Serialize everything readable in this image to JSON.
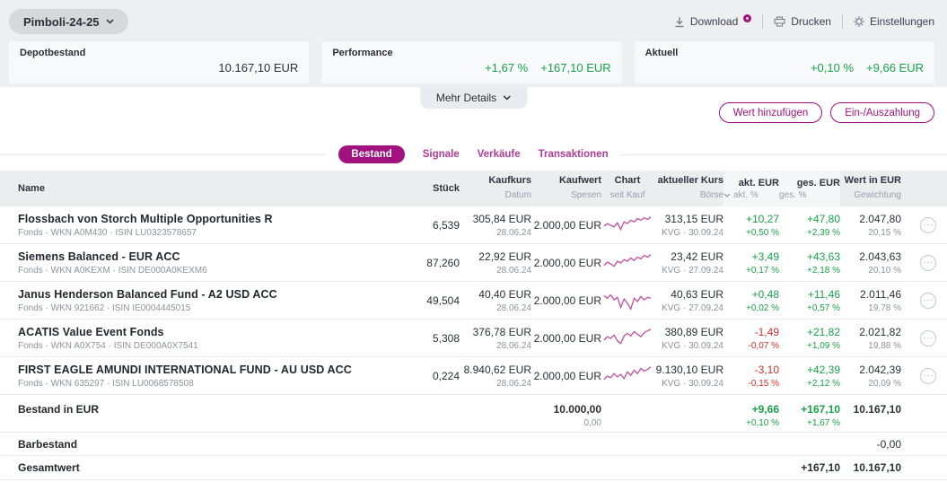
{
  "toolbar": {
    "portfolio": "Pimboli-24-25",
    "download": "Download",
    "print": "Drucken",
    "settings": "Einstellungen"
  },
  "summary": {
    "depot": {
      "label": "Depotbestand",
      "value": "10.167,10 EUR"
    },
    "performance": {
      "label": "Performance",
      "percent": "+1,67 %",
      "value": "+167,10 EUR"
    },
    "aktuell": {
      "label": "Aktuell",
      "percent": "+0,10 %",
      "value": "+9,66 EUR"
    },
    "more_details": "Mehr Details"
  },
  "actions": {
    "add_value": "Wert hinzufügen",
    "pay_in_out": "Ein-/Auszahlung"
  },
  "tabs": {
    "bestand": "Bestand",
    "signale": "Signale",
    "verkaeufe": "Verkäufe",
    "transaktionen": "Transaktionen"
  },
  "table": {
    "columns": {
      "name": "Name",
      "stueck": "Stück",
      "kaufkurs": "Kaufkurs",
      "datum": "Datum",
      "kaufwert": "Kaufwert",
      "spesen": "Spesen",
      "chart": "Chart",
      "seit_kauf": "seit Kauf",
      "kurs": "aktueller Kurs",
      "boerse": "Börse",
      "akt_eur": "akt. EUR",
      "akt_pct": "akt. %",
      "ges_eur": "ges. EUR",
      "ges_pct": "ges. %",
      "wert": "Wert in EUR",
      "gewichtung": "Gewichtung"
    },
    "rows": [
      {
        "name": "Flossbach von Storch Multiple Opportunities R",
        "meta": "Fonds · WKN A0M430 · ISIN LU0323578657",
        "stueck": "6,539",
        "kaufkurs": "305,84 EUR",
        "datum": "28.06.24",
        "kaufwert": "2.000,00 EUR",
        "kurs": "313,15 EUR",
        "boerse": "KVG · 30.09.24",
        "akt_eur": "+10,27",
        "akt_pct": "+0,50 %",
        "ges_eur": "+47,80",
        "ges_pct": "+2,39 %",
        "wert": "2.047,80",
        "gewichtung": "20,15 %",
        "spark": [
          13,
          10,
          12,
          14,
          9,
          17,
          8,
          10,
          6,
          8,
          4,
          6,
          3,
          5,
          2
        ]
      },
      {
        "name": "Siemens Balanced - EUR ACC",
        "meta": "Fonds · WKN A0KEXM · ISIN DE000A0KEXM6",
        "stueck": "87,260",
        "kaufkurs": "22,92 EUR",
        "datum": "28.06.24",
        "kaufwert": "2.000,00 EUR",
        "kurs": "23,42 EUR",
        "boerse": "KVG · 27.09.24",
        "akt_eur": "+3,49",
        "akt_pct": "+0,17 %",
        "ges_eur": "+43,63",
        "ges_pct": "+2,18 %",
        "wert": "2.043,63",
        "gewichtung": "20,10 %",
        "spark": [
          15,
          11,
          13,
          16,
          10,
          12,
          8,
          10,
          6,
          9,
          5,
          7,
          3,
          5,
          2
        ]
      },
      {
        "name": "Janus Henderson Balanced Fund - A2 USD ACC",
        "meta": "Fonds · WKN 921662 · ISIN IE0004445015",
        "stueck": "49,504",
        "kaufkurs": "40,40 EUR",
        "datum": "28.06.24",
        "kaufwert": "2.000,00 EUR",
        "kurs": "40,63 EUR",
        "boerse": "KVG · 27.09.24",
        "akt_eur": "+0,48",
        "akt_pct": "+0,02 %",
        "ges_eur": "+11,46",
        "ges_pct": "+0,57 %",
        "wert": "2.011,46",
        "gewichtung": "19,78 %",
        "spark": [
          6,
          9,
          5,
          11,
          8,
          20,
          10,
          15,
          22,
          9,
          13,
          7,
          11,
          8,
          9
        ]
      },
      {
        "name": "ACATIS Value Event Fonds",
        "meta": "Fonds · WKN A0X754 · ISIN DE000A0X7541",
        "stueck": "5,308",
        "kaufkurs": "376,78 EUR",
        "datum": "28.06.24",
        "kaufwert": "2.000,00 EUR",
        "kurs": "380,89 EUR",
        "boerse": "KVG · 30.09.24",
        "akt_eur": "-1,49",
        "akt_pct": "-0,07 %",
        "ges_eur": "+21,82",
        "ges_pct": "+1,09 %",
        "wert": "2.021,82",
        "gewichtung": "19,88 %",
        "spark": [
          14,
          10,
          12,
          8,
          15,
          18,
          9,
          6,
          9,
          4,
          7,
          10,
          5,
          3,
          1
        ]
      },
      {
        "name": "FIRST EAGLE AMUNDI INTERNATIONAL FUND - AU USD ACC",
        "meta": "Fonds · WKN 635297 · ISIN LU0068578508",
        "stueck": "0,224",
        "kaufkurs": "8.940,62 EUR",
        "datum": "28.06.24",
        "kaufwert": "2.000,00 EUR",
        "kurs": "9.130,10 EUR",
        "boerse": "KVG · 30.09.24",
        "akt_eur": "-3,10",
        "akt_pct": "-0,15 %",
        "ges_eur": "+42,39",
        "ges_pct": "+2,12 %",
        "wert": "2.042,39",
        "gewichtung": "20,09 %",
        "spark": [
          16,
          12,
          14,
          9,
          13,
          10,
          15,
          7,
          11,
          5,
          9,
          3,
          6,
          4,
          1
        ]
      }
    ],
    "footer": {
      "bestand": {
        "label": "Bestand in EUR",
        "kaufwert": "10.000,00",
        "spesen": "0,00",
        "akt_eur": "+9,66",
        "akt_pct": "+0,10 %",
        "ges_eur": "+167,10",
        "ges_pct": "+1,67 %",
        "wert": "10.167,10"
      },
      "barbestand": {
        "label": "Barbestand",
        "wert": "-0,00"
      },
      "gesamtwert": {
        "label": "Gesamtwert",
        "ges_eur": "+167,10",
        "wert": "10.167,10"
      }
    }
  },
  "colors": {
    "accent": "#a1127e",
    "positive": "#18a248",
    "negative": "#d23028",
    "sparkline": "#c2509f",
    "strip_bg": "#edeff1",
    "header_bg": "#ebedef"
  }
}
